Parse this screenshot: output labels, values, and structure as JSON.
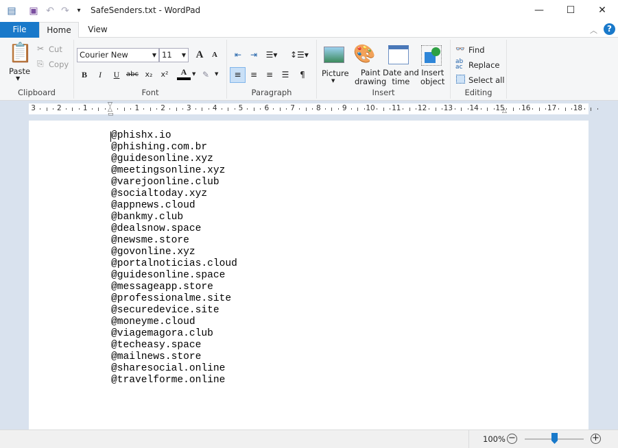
{
  "window": {
    "title": "SafeSenders.txt - WordPad",
    "minimize": "—",
    "maximize": "☐",
    "close": "✕"
  },
  "tabs": [
    {
      "label": "File"
    },
    {
      "label": "Home"
    },
    {
      "label": "View"
    }
  ],
  "ribbon": {
    "clipboard": {
      "label": "Clipboard",
      "paste": "Paste",
      "cut": "Cut",
      "copy": "Copy"
    },
    "font": {
      "label": "Font",
      "family": "Courier New",
      "size": "11"
    },
    "paragraph": {
      "label": "Paragraph"
    },
    "insert": {
      "label": "Insert",
      "picture": "Picture",
      "paint1": "Paint",
      "paint2": "drawing",
      "date1": "Date and",
      "date2": "time",
      "obj1": "Insert",
      "obj2": "object"
    },
    "editing": {
      "label": "Editing",
      "find": "Find",
      "replace": "Replace",
      "select_all": "Select all"
    }
  },
  "ruler": {
    "labels": [
      "3",
      "2",
      "1",
      "",
      "1",
      "2",
      "3",
      "4",
      "5",
      "6",
      "7",
      "8",
      "9",
      "10",
      "11",
      "12",
      "13",
      "14",
      "15",
      "16",
      "17",
      "18"
    ]
  },
  "document": {
    "lines": [
      "@phishx.io",
      "@phishing.com.br",
      "@guidesonline.xyz",
      "@meetingsonline.xyz",
      "@varejoonline.club",
      "@socialtoday.xyz",
      "@appnews.cloud",
      "@bankmy.club",
      "@dealsnow.space",
      "@newsme.store",
      "@govonline.xyz",
      "@portalnoticias.cloud",
      "@guidesonline.space",
      "@messageapp.store",
      "@professionalme.site",
      "@securedevice.site",
      "@moneyme.cloud",
      "@viagemagora.club",
      "@techeasy.space",
      "@mailnews.store",
      "@sharesocial.online",
      "@travelforme.online"
    ]
  },
  "status": {
    "zoom": "100%",
    "zoom_level": 100
  },
  "colors": {
    "accent": "#1979ca"
  }
}
